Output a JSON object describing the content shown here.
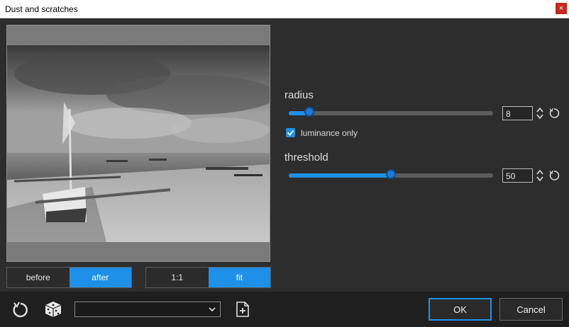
{
  "window": {
    "title": "Dust and scratches",
    "close_glyph": "×"
  },
  "preview": {
    "image": "black-and-white beach photo with outrigger boat"
  },
  "view_toggle": {
    "before": "before",
    "after": "after",
    "selected": "after"
  },
  "zoom_toggle": {
    "one_to_one": "1:1",
    "fit": "fit",
    "selected": "fit"
  },
  "radius": {
    "label": "radius",
    "value": "8",
    "slider_fraction": 0.1
  },
  "luminance": {
    "label": "luminance only",
    "checked": true
  },
  "threshold": {
    "label": "threshold",
    "value": "50",
    "slider_fraction": 0.5
  },
  "preset": {
    "value": ""
  },
  "buttons": {
    "ok": "OK",
    "cancel": "Cancel"
  },
  "colors": {
    "accent": "#1e90e8",
    "background": "#2d2d2d",
    "bottom_bar": "#1f1f1f"
  }
}
